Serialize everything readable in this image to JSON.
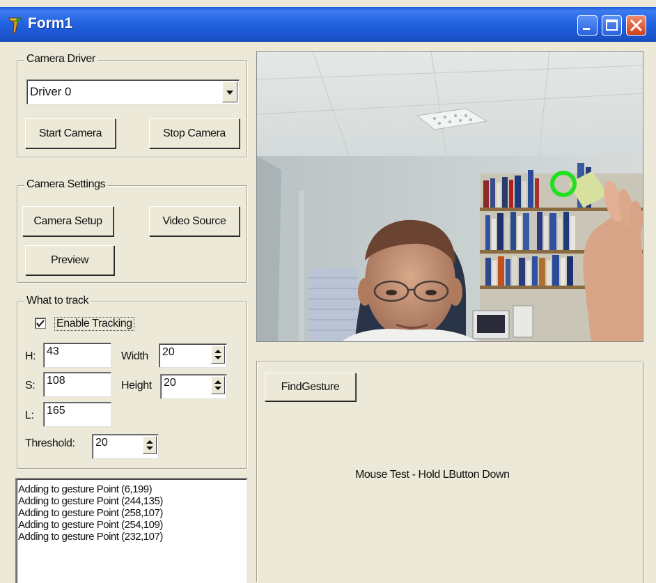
{
  "window": {
    "title": "Form1"
  },
  "camera_driver": {
    "legend": "Camera Driver",
    "selected_driver": "Driver 0",
    "start_label": "Start Camera",
    "stop_label": "Stop Camera"
  },
  "camera_settings": {
    "legend": "Camera Settings",
    "setup_label": "Camera Setup",
    "video_source_label": "Video Source",
    "preview_label": "Preview"
  },
  "tracking": {
    "legend": "What to track",
    "enable_label": "Enable Tracking",
    "enable_checked": true,
    "h_label": "H:",
    "h_value": "43",
    "s_label": "S:",
    "s_value": "108",
    "l_label": "L:",
    "l_value": "165",
    "width_label": "Width",
    "width_value": "20",
    "height_label": "Height",
    "height_value": "20",
    "threshold_label": "Threshold:",
    "threshold_value": "20"
  },
  "log": {
    "lines": [
      "Adding to gesture Point (6,199)",
      "Adding to gesture Point (244,135)",
      "Adding to gesture Point (258,107)",
      "Adding to gesture Point (254,109)",
      "Adding to gesture Point (232,107)"
    ]
  },
  "gesture_panel": {
    "find_label": "FindGesture",
    "mouse_test_text": "Mouse Test - Hold LButton Down"
  },
  "colors": {
    "titlebar": "#2161e0",
    "face": "#ece9d8",
    "tracker_ring": "#22e020"
  }
}
